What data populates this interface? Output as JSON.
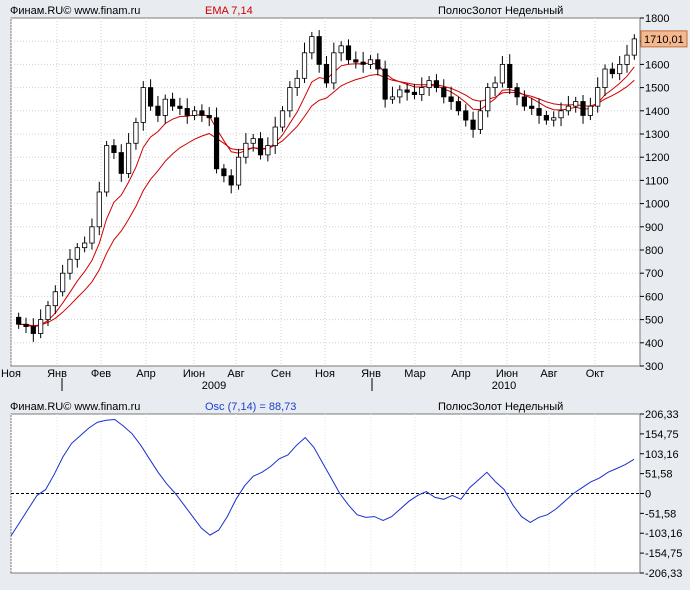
{
  "header_main": {
    "source": "Финам.RU© www.finam.ru",
    "indicator": "EMA 7,14",
    "instrument": "ПолюсЗолот Недельный"
  },
  "header_osc": {
    "source": "Финам.RU© www.finam.ru",
    "indicator": "Osc (7,14) = 88,73",
    "instrument": "ПолюсЗолот Недельный"
  },
  "chart_data": [
    {
      "type": "candlestick",
      "title": "ПолюсЗолот Недельный",
      "overlays": [
        "EMA 7",
        "EMA 14"
      ],
      "last_price_label": "1710,01",
      "ylim": [
        300,
        1800
      ],
      "y_ticks": [
        300,
        400,
        500,
        600,
        700,
        800,
        900,
        1000,
        1100,
        1200,
        1300,
        1400,
        1500,
        1600,
        1700,
        1800
      ],
      "x_month_labels": [
        "Ноя",
        "Янв",
        "Фев",
        "Апр",
        "Июн",
        "Авг",
        "Сен",
        "Ноя",
        "Янв",
        "Мар",
        "Апр",
        "Июн",
        "Авг",
        "Окт"
      ],
      "x_year_labels": [
        "2009",
        "2010"
      ],
      "close": [
        480,
        470,
        440,
        500,
        560,
        620,
        700,
        760,
        810,
        830,
        900,
        1050,
        1250,
        1220,
        1130,
        1260,
        1350,
        1500,
        1420,
        1380,
        1450,
        1420,
        1410,
        1380,
        1400,
        1380,
        1370,
        1150,
        1120,
        1080,
        1200,
        1260,
        1280,
        1210,
        1250,
        1330,
        1400,
        1500,
        1540,
        1650,
        1720,
        1600,
        1520,
        1650,
        1680,
        1620,
        1610,
        1600,
        1620,
        1580,
        1450,
        1460,
        1490,
        1480,
        1470,
        1500,
        1530,
        1500,
        1460,
        1440,
        1400,
        1360,
        1320,
        1400,
        1500,
        1520,
        1600,
        1500,
        1460,
        1420,
        1410,
        1380,
        1360,
        1370,
        1400,
        1420,
        1440,
        1380,
        1420,
        1500,
        1580,
        1560,
        1600,
        1640,
        1710
      ]
    },
    {
      "type": "line",
      "title": "Osc (7,14) = 88,73",
      "ylim": [
        -206.33,
        206.33
      ],
      "y_ticks": [
        206.33,
        154.75,
        103.16,
        51.58,
        0,
        -51.58,
        -103.16,
        -154.75,
        -206.33
      ],
      "y_tick_labels": [
        "206,33",
        "154,75",
        "103,16",
        "51,58",
        "0",
        "-51,58",
        "-103,16",
        "-154,75",
        "-206,33"
      ],
      "values": [
        -110,
        -75,
        -40,
        -5,
        10,
        50,
        95,
        130,
        150,
        170,
        185,
        190,
        192,
        175,
        155,
        125,
        90,
        55,
        25,
        0,
        -30,
        -60,
        -90,
        -108,
        -95,
        -60,
        -15,
        20,
        45,
        55,
        70,
        90,
        100,
        125,
        145,
        120,
        80,
        40,
        0,
        -30,
        -55,
        -62,
        -60,
        -70,
        -60,
        -40,
        -20,
        -5,
        5,
        -10,
        -15,
        -5,
        -15,
        15,
        35,
        55,
        30,
        10,
        -30,
        -60,
        -75,
        -62,
        -55,
        -40,
        -20,
        0,
        15,
        30,
        40,
        55,
        65,
        75,
        88.73
      ]
    }
  ],
  "colors": {
    "background": "#e8ebef",
    "plot_bg": "#ffffff",
    "ema_line": "#d00000",
    "osc_line": "#1a2fd0",
    "last_price_bg": "#f5b98f"
  }
}
